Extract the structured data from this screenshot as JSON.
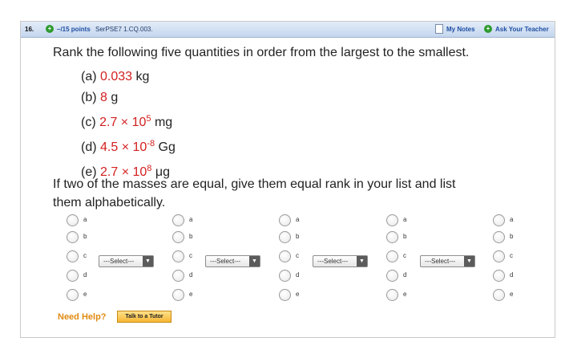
{
  "header": {
    "question_number": "16.",
    "points": "–/15 points",
    "question_id": "SerPSE7 1.CQ.003.",
    "my_notes": "My Notes",
    "ask_teacher": "Ask Your Teacher",
    "plus_symbol": "+"
  },
  "question": {
    "prompt": "Rank the following five quantities in order from the largest to the smallest.",
    "items": [
      {
        "letter": "(a)",
        "value": "0.033",
        "unit": "kg"
      },
      {
        "letter": "(b)",
        "value": "8",
        "unit": "g"
      },
      {
        "letter": "(c)",
        "value": "2.7 × 10",
        "exp": "5",
        "unit": "mg"
      },
      {
        "letter": "(d)",
        "value": "4.5 × 10",
        "exp": "-8",
        "unit": "Gg"
      },
      {
        "letter": "(e)",
        "value": "2.7 × 10",
        "exp": "8",
        "unit": "μg"
      }
    ],
    "instruction_line1": "If two of the masses are equal, give them equal rank in your list and list",
    "instruction_line2": "them alphabetically."
  },
  "answer_options": [
    "a",
    "b",
    "c",
    "d",
    "e"
  ],
  "select_placeholder": "---Select---",
  "select_arrow": "▼",
  "help": {
    "label": "Need Help?",
    "tutor_button": "Talk to a Tutor"
  },
  "colors": {
    "value_red": "#d32020",
    "header_blue": "#1f4fa3",
    "help_orange": "#e08a12"
  }
}
